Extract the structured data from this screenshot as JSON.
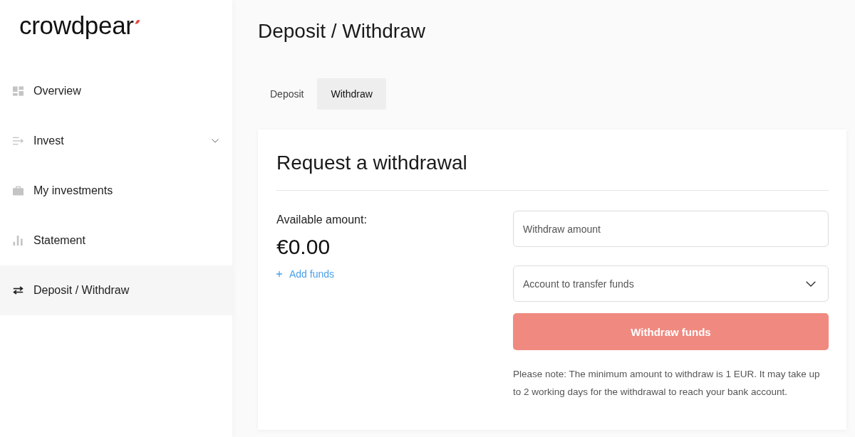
{
  "brand": {
    "logo_text": "crowdpear"
  },
  "sidebar": {
    "items": [
      {
        "label": "Overview",
        "kind": "link",
        "selected": false
      },
      {
        "label": "Invest",
        "kind": "group",
        "selected": false
      },
      {
        "label": "My investments",
        "kind": "link",
        "selected": false
      },
      {
        "label": "Statement",
        "kind": "link",
        "selected": false
      },
      {
        "label": "Deposit / Withdraw",
        "kind": "link",
        "selected": true
      }
    ]
  },
  "page": {
    "title": "Deposit / Withdraw"
  },
  "tabs": [
    {
      "label": "Deposit",
      "selected": false
    },
    {
      "label": "Withdraw",
      "selected": true
    }
  ],
  "card": {
    "title": "Request a withdrawal",
    "available_label": "Available amount:",
    "available_amount": "€0.00",
    "add_funds_link": "Add funds",
    "amount_field": {
      "placeholder": "Withdraw amount"
    },
    "account_select": {
      "placeholder": "Account to transfer funds"
    },
    "submit_button": {
      "label": "Withdraw funds",
      "disabled": true
    },
    "note": "Please note: The minimum amount to withdraw is 1 EUR. It may take up to 2 working days for the withdrawal to reach your bank account."
  }
}
